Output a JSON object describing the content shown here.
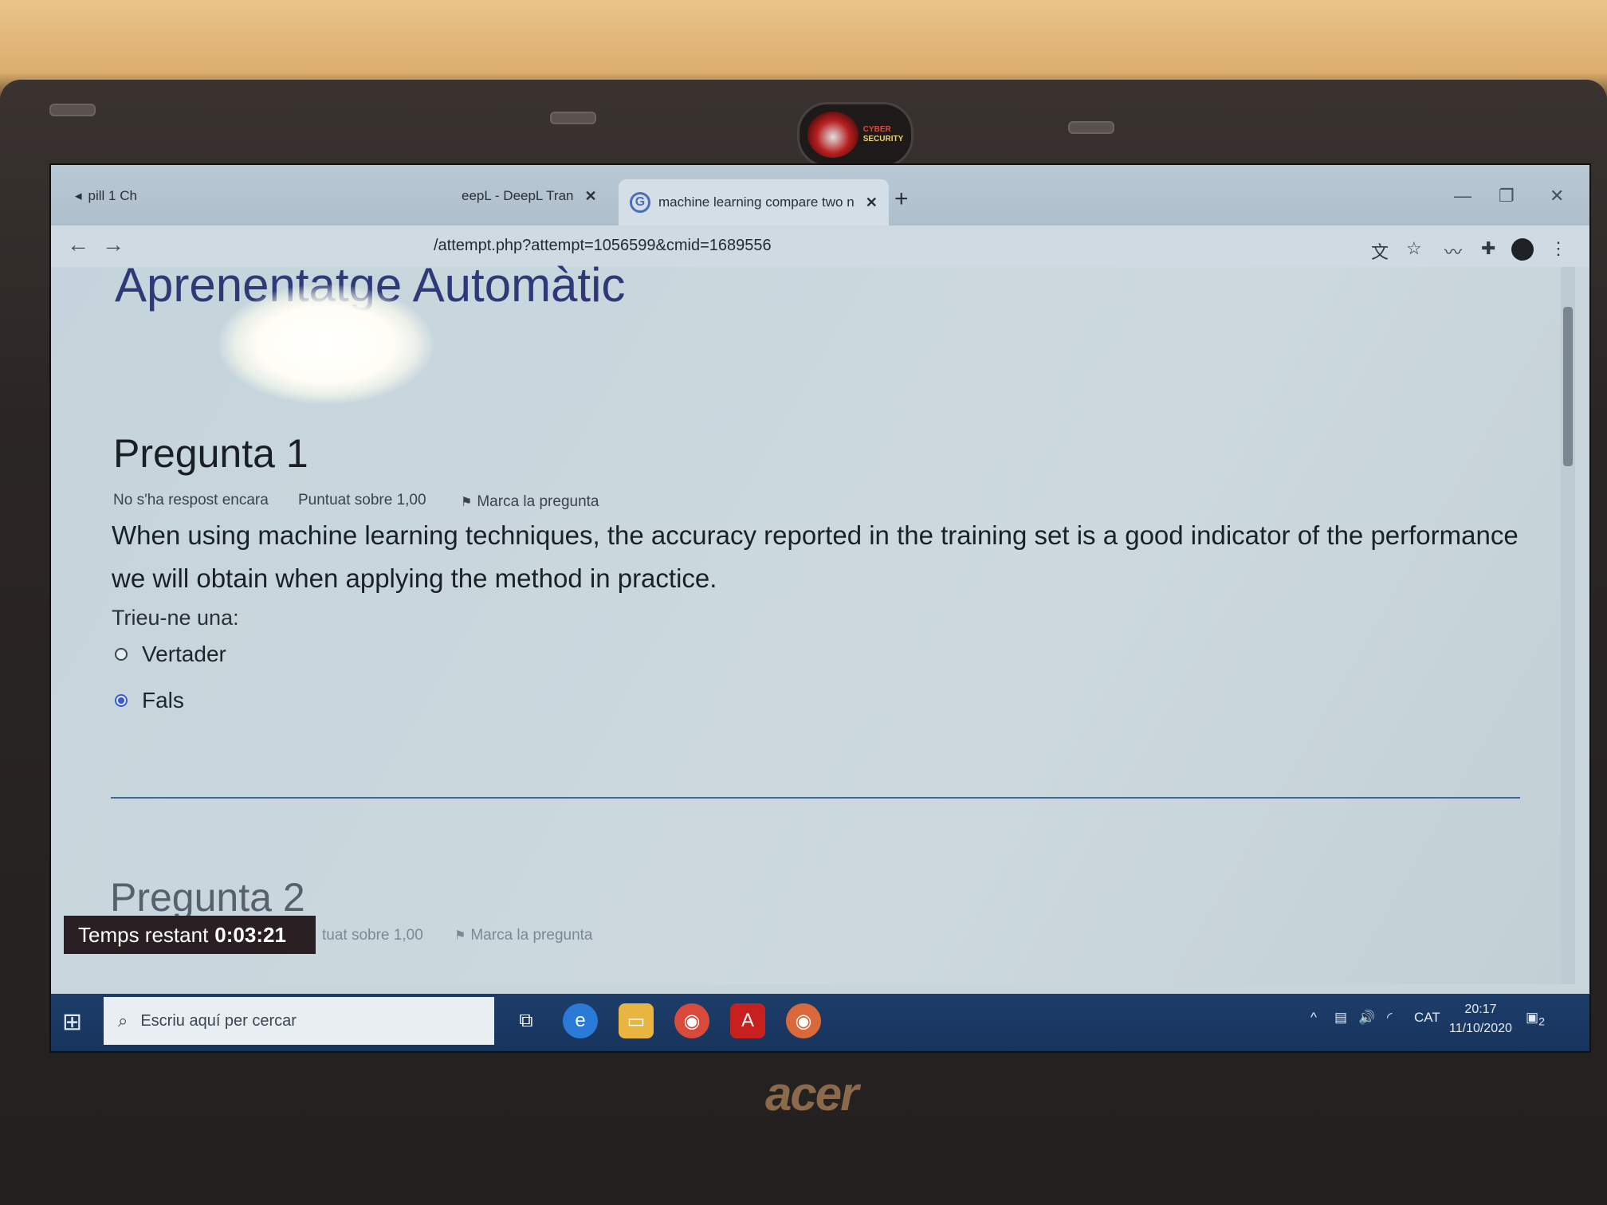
{
  "browser": {
    "tabs": [
      {
        "label": "pill 1 Ch"
      },
      {
        "label": "eepL - DeepL Tran"
      },
      {
        "label": "machine learning compare two n"
      }
    ],
    "url": "/attempt.php?attempt=1056599&cmid=1689556"
  },
  "page": {
    "course_title": "Aprenentatge Automàtic",
    "question1": {
      "title": "Pregunta 1",
      "status": "No s'ha respost encara",
      "points": "Puntuat sobre 1,00",
      "flag": "Marca la pregunta",
      "text": "When using machine learning techniques, the accuracy reported in the training set is a good indicator of the performance we will obtain when applying the method in practice.",
      "prompt": "Trieu-ne una:",
      "options": [
        {
          "label": "Vertader",
          "selected": false
        },
        {
          "label": "Fals",
          "selected": true
        }
      ]
    },
    "question2": {
      "title": "Pregunta 2",
      "points": "tuat sobre 1,00",
      "flag": "Marca la pregunta"
    },
    "timer": {
      "label": "Temps restant",
      "value": "0:03:21"
    }
  },
  "taskbar": {
    "search_placeholder": "Escriu aquí per cercar",
    "language": "CAT",
    "time": "20:17",
    "date": "11/10/2020",
    "notifications": "2"
  },
  "hardware": {
    "brand": "acer",
    "sticker_line1": "CYBER",
    "sticker_line2": "SECURITY"
  },
  "colors": {
    "accent": "#3a5bd0",
    "course_title": "#2e3a78",
    "taskbar": "#17345d"
  }
}
